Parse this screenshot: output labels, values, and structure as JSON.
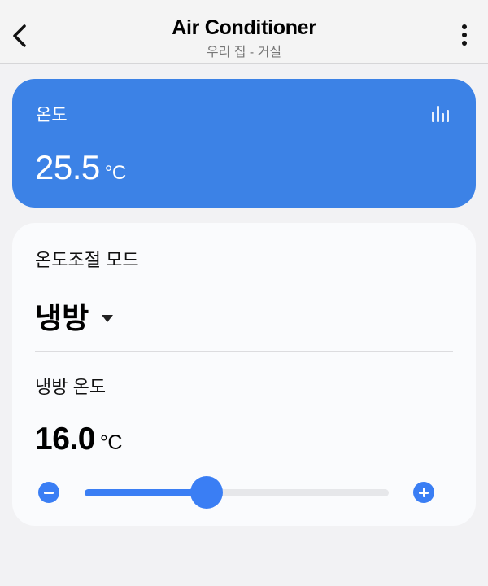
{
  "header": {
    "title": "Air Conditioner",
    "subtitle": "우리 집 - 거실",
    "back_icon": "chevron-left-icon",
    "more_icon": "more-vertical-icon"
  },
  "temperature_card": {
    "label": "온도",
    "value": "25.5",
    "unit": "°C",
    "icon": "bar-chart-icon",
    "background_color": "#3c82e6"
  },
  "control_card": {
    "mode_label": "온도조절 모드",
    "mode_value": "냉방",
    "setpoint_label": "냉방 온도",
    "setpoint_value": "16.0",
    "setpoint_unit": "°C",
    "slider": {
      "fraction": 0.4,
      "accent_color": "#3a7ef4"
    },
    "minus_icon": "minus-circle-icon",
    "plus_icon": "plus-circle-icon"
  }
}
